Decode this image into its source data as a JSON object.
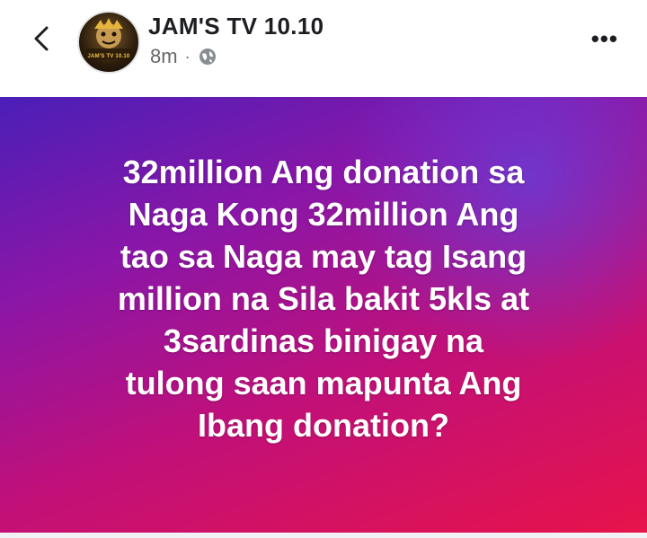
{
  "header": {
    "page_name": "JAM'S TV 10.10",
    "time": "8m",
    "separator": "·",
    "avatar_text": "JAM'S TV 10.10",
    "privacy_icon": "globe-icon",
    "back_icon": "chevron-left-icon",
    "more_label": "•••"
  },
  "post": {
    "lines": [
      "32million Ang donation sa",
      "Naga Kong 32million Ang",
      "tao sa Naga may tag Isang",
      "million na Sila bakit 5kls at",
      "3sardinas binigay na",
      "tulong saan mapunta Ang",
      "Ibang donation?"
    ],
    "gradient_colors": [
      "#4a1fb8",
      "#8a16a8",
      "#c0107a",
      "#e8134a"
    ]
  }
}
